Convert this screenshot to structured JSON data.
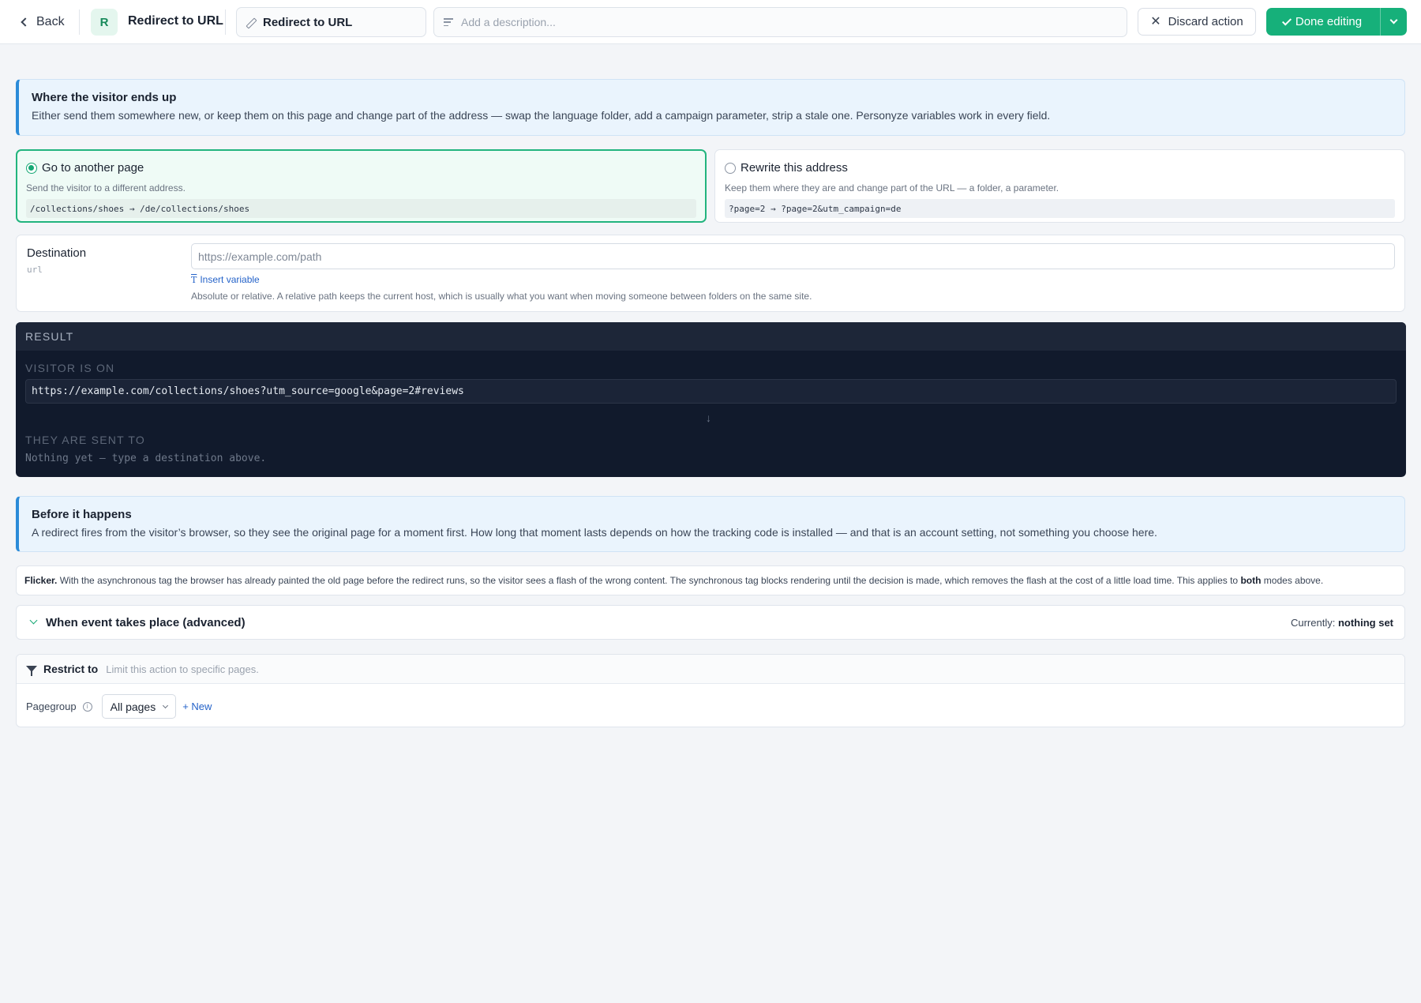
{
  "header": {
    "back_label": "Back",
    "avatar_letter": "R",
    "title": "Redirect to URL",
    "name_value": "Redirect to URL",
    "description_placeholder": "Add a description...",
    "discard_label": "Discard action",
    "done_label": "Done editing"
  },
  "intro": {
    "title": "Where the visitor ends up",
    "text": "Either send them somewhere new, or keep them on this page and change part of the address — swap the language folder, add a campaign parameter, strip a stale one. Personyze variables work in every field."
  },
  "modes": [
    {
      "label": "Go to another page",
      "description": "Send the visitor to a different address.",
      "example": "/collections/shoes → /de/collections/shoes",
      "selected": true
    },
    {
      "label": "Rewrite this address",
      "description": "Keep them where they are and change part of the URL — a folder, a parameter.",
      "example": "?page=2 → ?page=2&utm_campaign=de",
      "selected": false
    }
  ],
  "destination": {
    "label": "Destination",
    "type": "url",
    "value": "",
    "placeholder": "https://example.com/path",
    "insert_variable": "Insert variable",
    "help": "Absolute or relative. A relative path keeps the current host, which is usually what you want when moving someone between folders on the same site."
  },
  "result": {
    "heading": "RESULT",
    "visitor_label": "VISITOR IS ON",
    "visitor_url": "https://example.com/collections/shoes?utm_source=google&page=2#reviews",
    "arrow": "↓",
    "sent_label": "THEY ARE SENT TO",
    "sent_value": "Nothing yet — type a destination above."
  },
  "before": {
    "title": "Before it happens",
    "text": "A redirect fires from the visitor’s browser, so they see the original page for a moment first. How long that moment lasts depends on how the tracking code is installed — and that is an account setting, not something you choose here."
  },
  "flicker": {
    "lead": "Flicker.",
    "text": "With the asynchronous tag the browser has already painted the old page before the redirect runs, so the visitor sees a flash of the wrong content. The synchronous tag blocks rendering until the decision is made, which removes the flash at the cost of a little load time. This applies to",
    "bold": "both",
    "tail": "modes above."
  },
  "advanced": {
    "title": "When event takes place (advanced)",
    "currently_label": "Currently:",
    "currently_value": "nothing set"
  },
  "restrict": {
    "title": "Restrict to",
    "subtitle": "Limit this action to specific pages.",
    "pagegroup_label": "Pagegroup",
    "info_glyph": "i",
    "pagegroup_value": "All pages",
    "new_label": "+ New"
  },
  "colors": {
    "accent_green": "#16b07a",
    "info_blue": "#2b8bd8",
    "result_bg": "#111a2c",
    "link_blue": "#2563c9"
  }
}
